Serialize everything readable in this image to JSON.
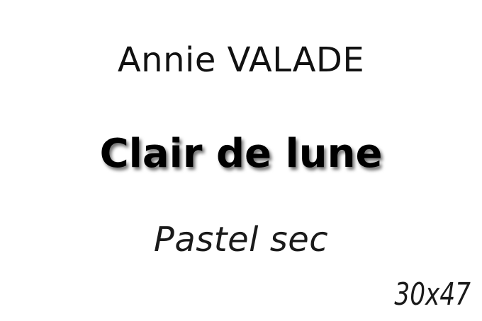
{
  "label": {
    "artist": "Annie VALADE",
    "title": "Clair de lune",
    "medium": "Pastel sec",
    "dimensions": "30x47"
  }
}
